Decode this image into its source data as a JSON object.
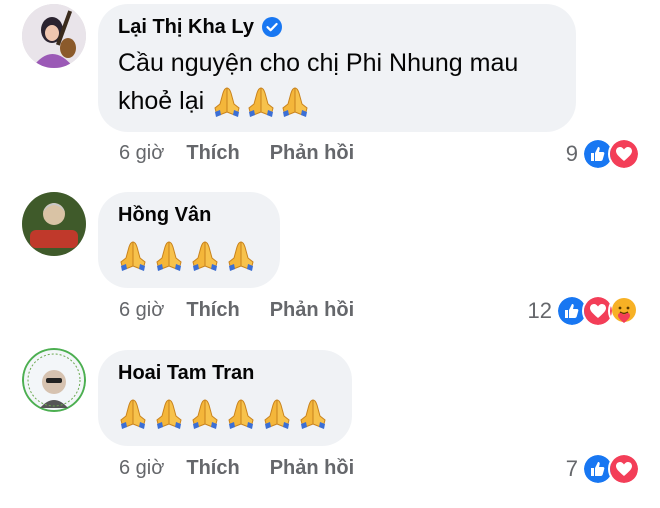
{
  "comments": [
    {
      "author": "Lại Thị Kha Ly",
      "text": "Cầu nguyện cho chị Phi Nhung mau khoẻ lại 🙏🙏🙏",
      "text_line1": "Cầu nguyện cho chị Phi Nhung mau",
      "text_line2": "khoẻ lại",
      "verified": true,
      "time": "6 giờ",
      "like_label": "Thích",
      "reply_label": "Phản hồi",
      "reaction_count": "9",
      "reactions": [
        "like-icon",
        "love-icon"
      ]
    },
    {
      "author": "Hồng Vân",
      "emoji_count": 4,
      "time": "6 giờ",
      "like_label": "Thích",
      "reply_label": "Phản hồi",
      "reaction_count": "12",
      "reactions": [
        "like-icon",
        "love-icon",
        "care-icon"
      ]
    },
    {
      "author": "Hoai Tam Tran",
      "emoji_count": 6,
      "time": "6 giờ",
      "like_label": "Thích",
      "reply_label": "Phản hồi",
      "reaction_count": "7",
      "reactions": [
        "like-icon",
        "love-icon"
      ]
    }
  ],
  "colors": {
    "like": "#1877f2",
    "love": "#f33e58",
    "care": "#f7b125",
    "bubble": "#f0f2f5",
    "meta": "#65676b"
  }
}
